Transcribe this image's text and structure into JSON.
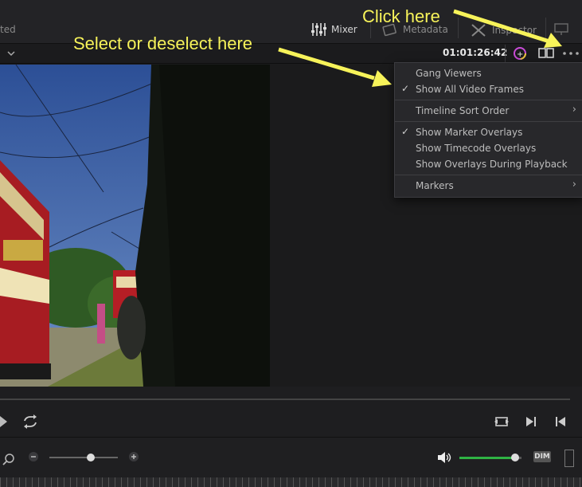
{
  "header": {
    "left_fragment": "ted",
    "tabs": [
      {
        "label": "Mixer",
        "icon": "mixer-icon"
      },
      {
        "label": "Metadata",
        "icon": "metadata-icon"
      },
      {
        "label": "Inspector",
        "icon": "inspector-icon"
      }
    ]
  },
  "viewer": {
    "timecode": "01:01:26:42"
  },
  "menu": {
    "items": [
      {
        "label": "Gang Viewers",
        "checked": false,
        "submenu": false
      },
      {
        "label": "Show All Video Frames",
        "checked": true,
        "submenu": false
      },
      {
        "label": "Timeline Sort Order",
        "checked": false,
        "submenu": true
      },
      {
        "label": "Show Marker Overlays",
        "checked": true,
        "submenu": false
      },
      {
        "label": "Show Timecode Overlays",
        "checked": false,
        "submenu": false
      },
      {
        "label": "Show Overlays During Playback",
        "checked": false,
        "submenu": false
      },
      {
        "label": "Markers",
        "checked": false,
        "submenu": true
      }
    ]
  },
  "annotations": {
    "click_here": "Click here",
    "select_here": "Select or deselect here"
  },
  "audio": {
    "dim_label": "DIM",
    "volume": 0.9
  },
  "zoom": {
    "level": 0.6
  },
  "colors": {
    "accent_green": "#2fb344",
    "annotation_yellow": "#f7f35a",
    "menu_bg": "#28282b"
  }
}
